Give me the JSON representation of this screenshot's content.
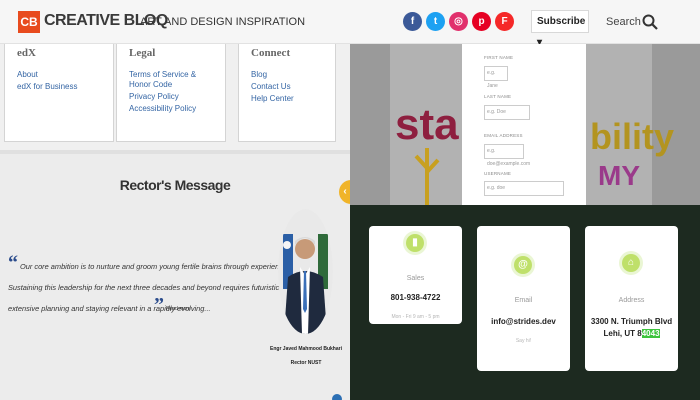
{
  "header": {
    "logo_mark": "CB",
    "logo_text": "CREATIVE BLOQ",
    "tagline": "ART AND DESIGN INSPIRATION",
    "social": [
      {
        "name": "facebook",
        "glyph": "f",
        "color": "#3b5998"
      },
      {
        "name": "twitter",
        "glyph": "t",
        "color": "#1da1f2"
      },
      {
        "name": "instagram",
        "glyph": "◎",
        "color": "#e1306c"
      },
      {
        "name": "pinterest",
        "glyph": "p",
        "color": "#e60023"
      },
      {
        "name": "flipboard",
        "glyph": "F",
        "color": "#f52828"
      }
    ],
    "subscribe_label": "Subscribe ▾",
    "search_label": "Search"
  },
  "edx_footer": {
    "columns": [
      {
        "heading": "edX",
        "links": [
          "About",
          "edX for Business"
        ]
      },
      {
        "heading": "Legal",
        "links": [
          "Terms of Service &",
          "Honor Code",
          "Privacy Policy",
          "Accessibility Policy"
        ]
      },
      {
        "heading": "Connect",
        "links": [
          "Blog",
          "Contact Us",
          "Help Center"
        ]
      }
    ]
  },
  "rector": {
    "title": "Rector's Message",
    "quote_lines": [
      "Our core ambition is to nurture and groom young fertile brains through experiential learning.",
      "Sustaining this leadership for the next three decades and beyond requires futuristic thinking,",
      "extensive planning and staying relevant in a rapidly evolving..."
    ],
    "read_more": "Read more",
    "name": "Engr Javed Mahmood Bukhari",
    "role": "Rector NUST"
  },
  "signup": {
    "bg_word_left": "sta",
    "bg_word_right": "bility",
    "bg_word_bottom": "MY",
    "fields": [
      {
        "label": "FIRST NAME",
        "placeholder": "e.g. Jane"
      },
      {
        "label": "LAST NAME",
        "placeholder": "e.g. Doe"
      },
      {
        "label": "EMAIL ADDRESS",
        "placeholder": "e.g. doe@example.com"
      },
      {
        "label": "USERNAME",
        "placeholder": "e.g. doe"
      }
    ]
  },
  "contact": {
    "cards": [
      {
        "icon": "phone-icon",
        "glyph": "▮",
        "label": "Sales",
        "value": "801-938-4722",
        "note": "Mon - Fri 9 am - 5 pm"
      },
      {
        "icon": "at-icon",
        "glyph": "@",
        "label": "Email",
        "value": "info@strides.dev",
        "note": "Say hi!"
      },
      {
        "icon": "location-icon",
        "glyph": "⌂",
        "label": "Address",
        "value_line1": "3300 N. Triumph Blvd",
        "value_line2_prefix": "Lehi, UT 8",
        "value_line2_highlight": "4043"
      }
    ]
  }
}
